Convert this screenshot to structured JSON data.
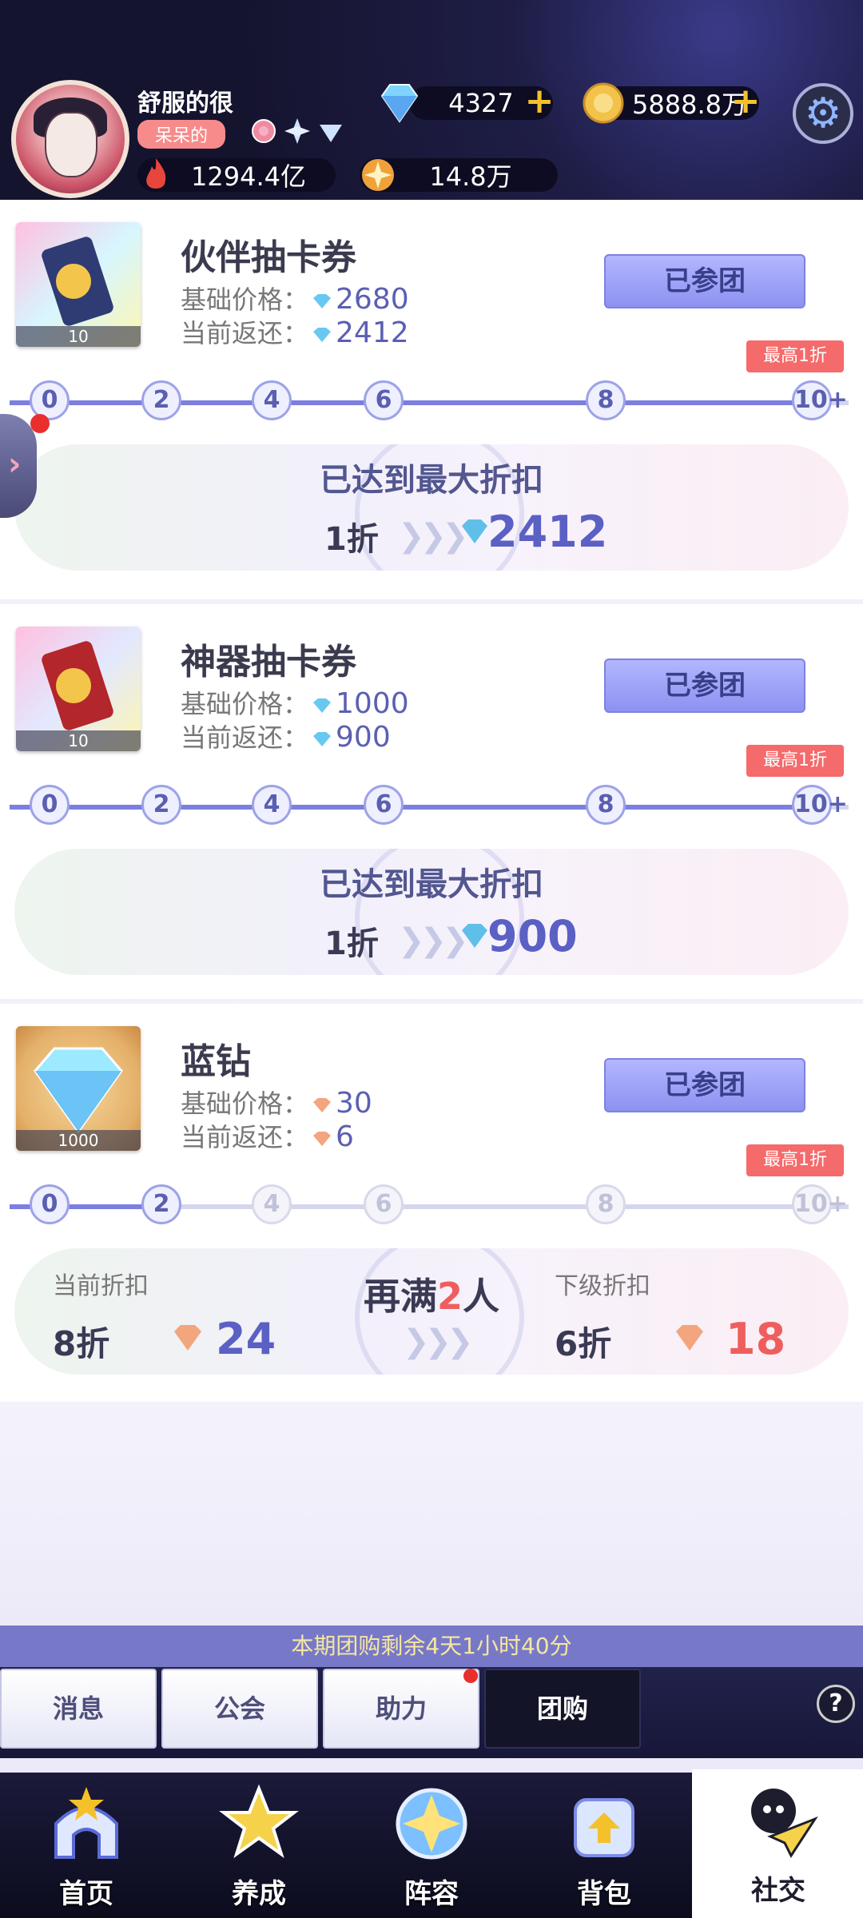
{
  "header": {
    "username": "舒服的很",
    "tag": "呆呆的",
    "diamonds": "4327",
    "gold": "5888.8万",
    "power": "1294.4亿",
    "stars": "14.8万"
  },
  "cards": [
    {
      "title": "伙伴抽卡券",
      "qty": "10",
      "base_label": "基础价格：",
      "base_price": "2680",
      "current_label": "当前返还：",
      "current_price": "2412",
      "joined": "已参团",
      "max_tag": "最高1折",
      "nodes": [
        "0",
        "2",
        "4",
        "6",
        "8",
        "10+"
      ],
      "progress": 1.0,
      "panel_head": "已达到最大折扣",
      "panel_rate": "1折",
      "panel_price": "2412"
    },
    {
      "title": "神器抽卡券",
      "qty": "10",
      "base_label": "基础价格：",
      "base_price": "1000",
      "current_label": "当前返还：",
      "current_price": "900",
      "joined": "已参团",
      "max_tag": "最高1折",
      "nodes": [
        "0",
        "2",
        "4",
        "6",
        "8",
        "10+"
      ],
      "progress": 1.0,
      "panel_head": "已达到最大折扣",
      "panel_rate": "1折",
      "panel_price": "900"
    },
    {
      "title": "蓝钻",
      "qty": "1000",
      "base_label": "基础价格：",
      "base_price": "30",
      "current_label": "当前返还：",
      "current_price": "6",
      "joined": "已参团",
      "max_tag": "最高1折",
      "nodes": [
        "0",
        "2",
        "4",
        "6",
        "8",
        "10+"
      ],
      "progress": 0.2,
      "cur_head": "当前折扣",
      "cur_rate": "8折",
      "cur_price": "24",
      "center_pre": "再满",
      "center_num": "2",
      "center_post": "人",
      "next_head": "下级折扣",
      "next_rate": "6折",
      "next_price": "18"
    }
  ],
  "timer": "本期团购剩余4天1小时40分",
  "subtabs": [
    "消息",
    "公会",
    "助力",
    "团购"
  ],
  "nav": [
    "首页",
    "养成",
    "阵容",
    "背包",
    "社交"
  ],
  "colors": {
    "accent": "#7a7fe0",
    "red": "#ef5e5e",
    "gold": "#f5c12a"
  }
}
